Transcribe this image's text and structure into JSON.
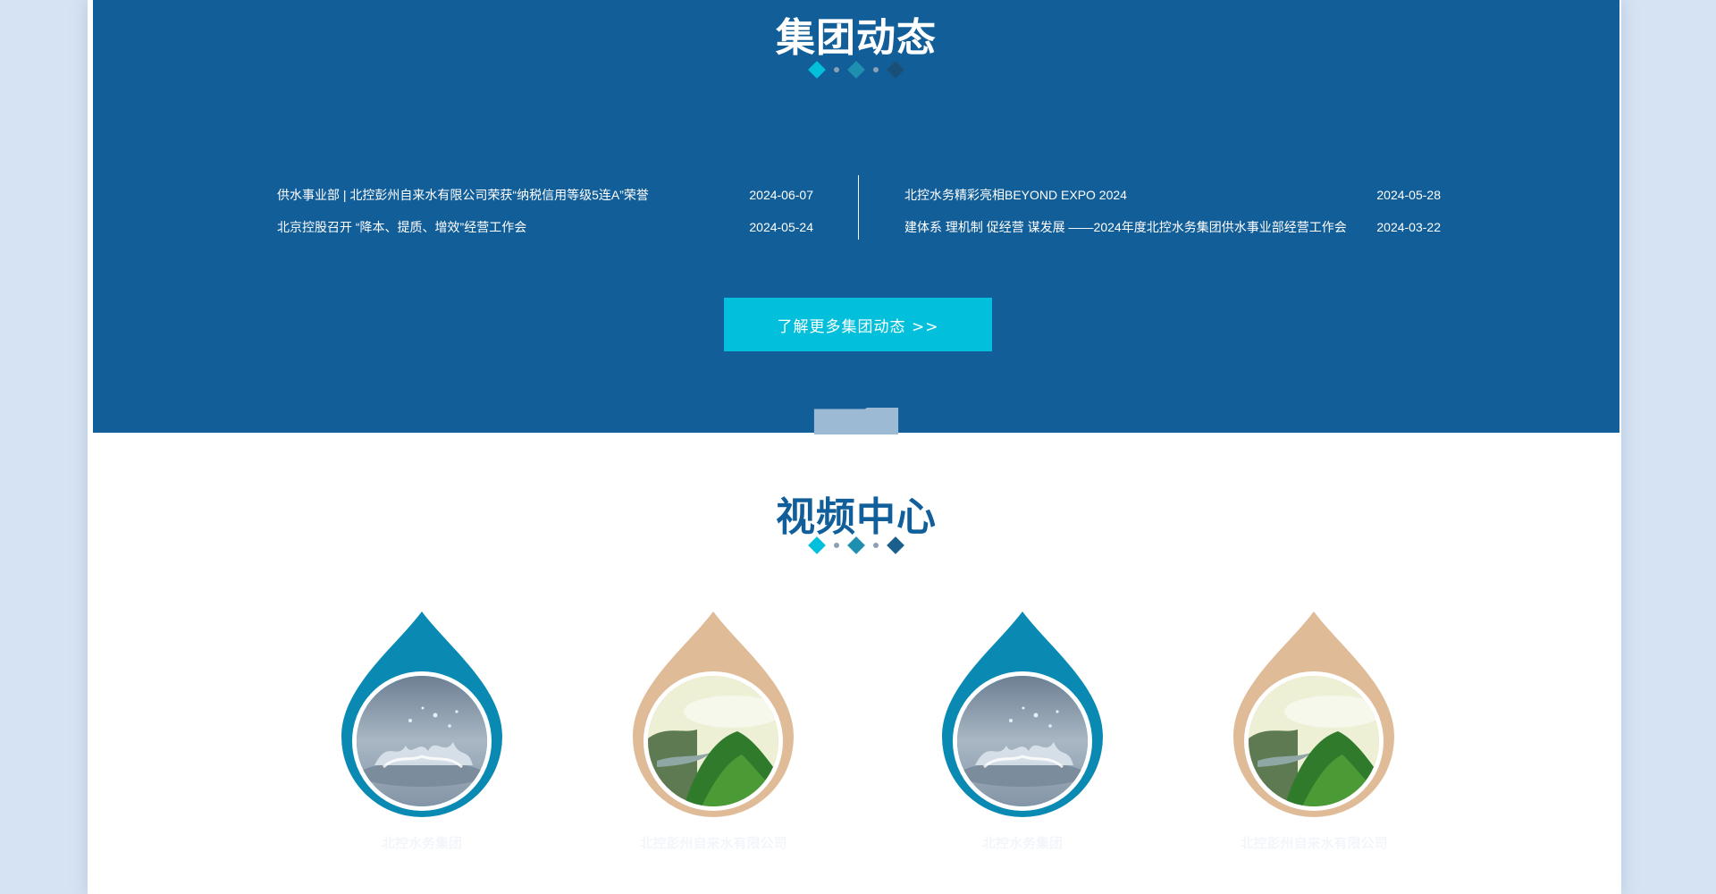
{
  "news": {
    "title": "集团动态",
    "left_items": [
      {
        "title": "供水事业部 | 北控彭州自来水有限公司荣获“纳税信用等级5连A”荣誉",
        "date": "2024-06-07"
      },
      {
        "title": "北京控股召开 “降本、提质、增效”经营工作会",
        "date": "2024-05-24"
      }
    ],
    "right_items": [
      {
        "title": "北控水务精彩亮相BEYOND EXPO 2024",
        "date": "2024-05-28"
      },
      {
        "title": "建体系 理机制 促经营 谋发展 ——2024年度北控水务集团供水事业部经营工作会",
        "date": "2024-03-22"
      }
    ],
    "more_label": "了解更多集团动态 >>"
  },
  "video": {
    "title": "视频中心",
    "cards": [
      {
        "label": "北控水务集团",
        "drop_color": "#0a8ab2",
        "thumb": "water-splash"
      },
      {
        "label": "北控彭州自来水有限公司",
        "drop_color": "#dfbb98",
        "thumb": "green-mountain"
      },
      {
        "label": "北控水务集团",
        "drop_color": "#0a8ab2",
        "thumb": "water-splash"
      },
      {
        "label": "北控彭州自来水有限公司",
        "drop_color": "#dfbb98",
        "thumb": "green-mountain"
      }
    ]
  },
  "colors": {
    "page_bg": "#d6e3f3",
    "news_bg": "#125e98",
    "video_bg": "#9dbad4",
    "accent_cyan": "#02c0dc",
    "diamond_teal": "#1f8fb0",
    "diamond_navy": "#1b5f8c",
    "title_blue": "#115f9a"
  }
}
